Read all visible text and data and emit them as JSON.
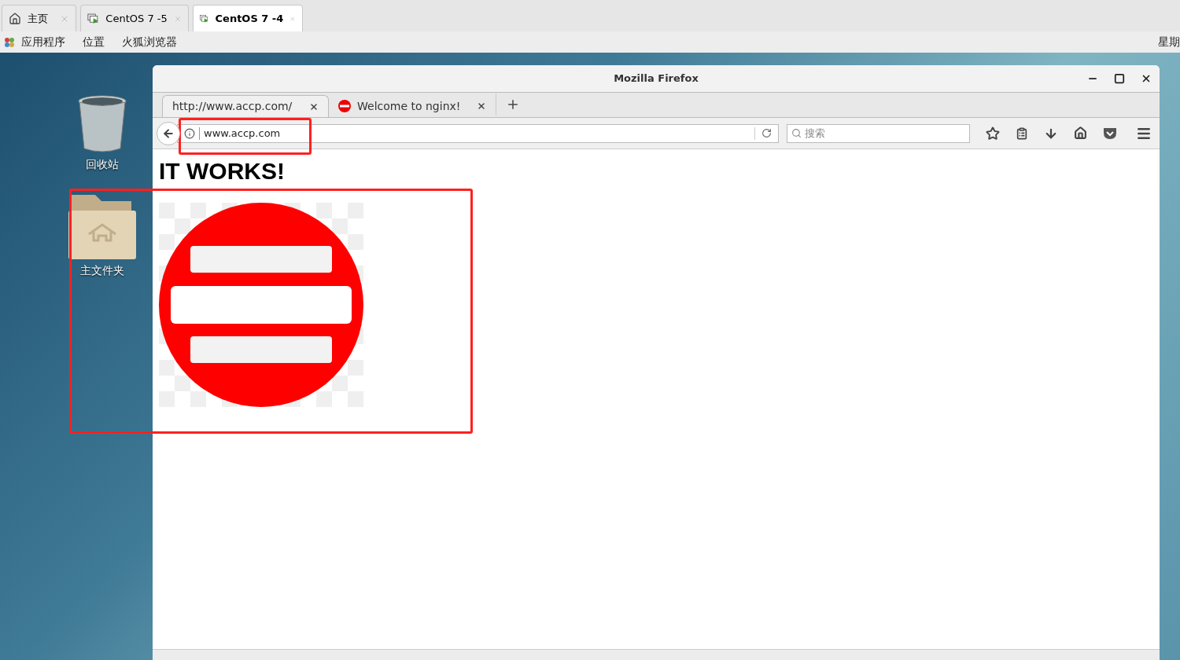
{
  "vm_tabs": [
    {
      "label": "主页",
      "kind": "home",
      "selected": false
    },
    {
      "label": "CentOS 7 -5",
      "kind": "vm",
      "selected": false
    },
    {
      "label": "CentOS 7 -4",
      "kind": "vm",
      "selected": true
    }
  ],
  "menu_bar": {
    "items": [
      "应用程序",
      "位置",
      "火狐浏览器"
    ],
    "clock": "星期"
  },
  "desktop_icons": [
    {
      "label": "回收站",
      "kind": "trash"
    },
    {
      "label": "主文件夹",
      "kind": "home-folder"
    }
  ],
  "window": {
    "title": "Mozilla Firefox"
  },
  "browser_tabs": [
    {
      "label": "http://www.accp.com/",
      "selected": true,
      "favicon": false
    },
    {
      "label": "Welcome to nginx!",
      "selected": false,
      "favicon": true
    }
  ],
  "address_bar": {
    "value": "www.accp.com"
  },
  "search": {
    "placeholder": "搜索"
  },
  "page": {
    "heading": "IT WORKS!"
  }
}
